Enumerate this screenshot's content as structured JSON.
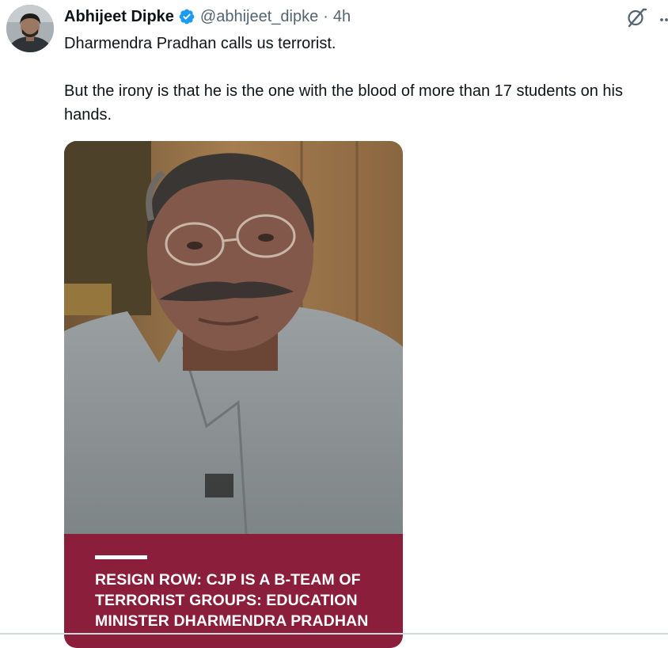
{
  "tweet": {
    "author_name": "Abhijeet Dipke",
    "handle": "@abhijeet_dipke",
    "separator": "·",
    "time": "4h",
    "verified": true,
    "text_line1": "Dharmendra Pradhan calls us terrorist.",
    "text_line2": "But the irony is that he is the one with the blood of more than 17 students on his hands."
  },
  "media": {
    "caption_headline": "RESIGN ROW: CJP IS A B-TEAM OF TERRORIST GROUPS: EDUCATION MINISTER DHARMENDRA PRADHAN"
  },
  "icons": {
    "verified": "verified-badge-icon",
    "grok": "grok-icon",
    "more": "more-options-icon"
  },
  "colors": {
    "verified_badge": "#1d9bf0",
    "secondary_text": "#536471",
    "caption_background": "#8b1f3b"
  }
}
